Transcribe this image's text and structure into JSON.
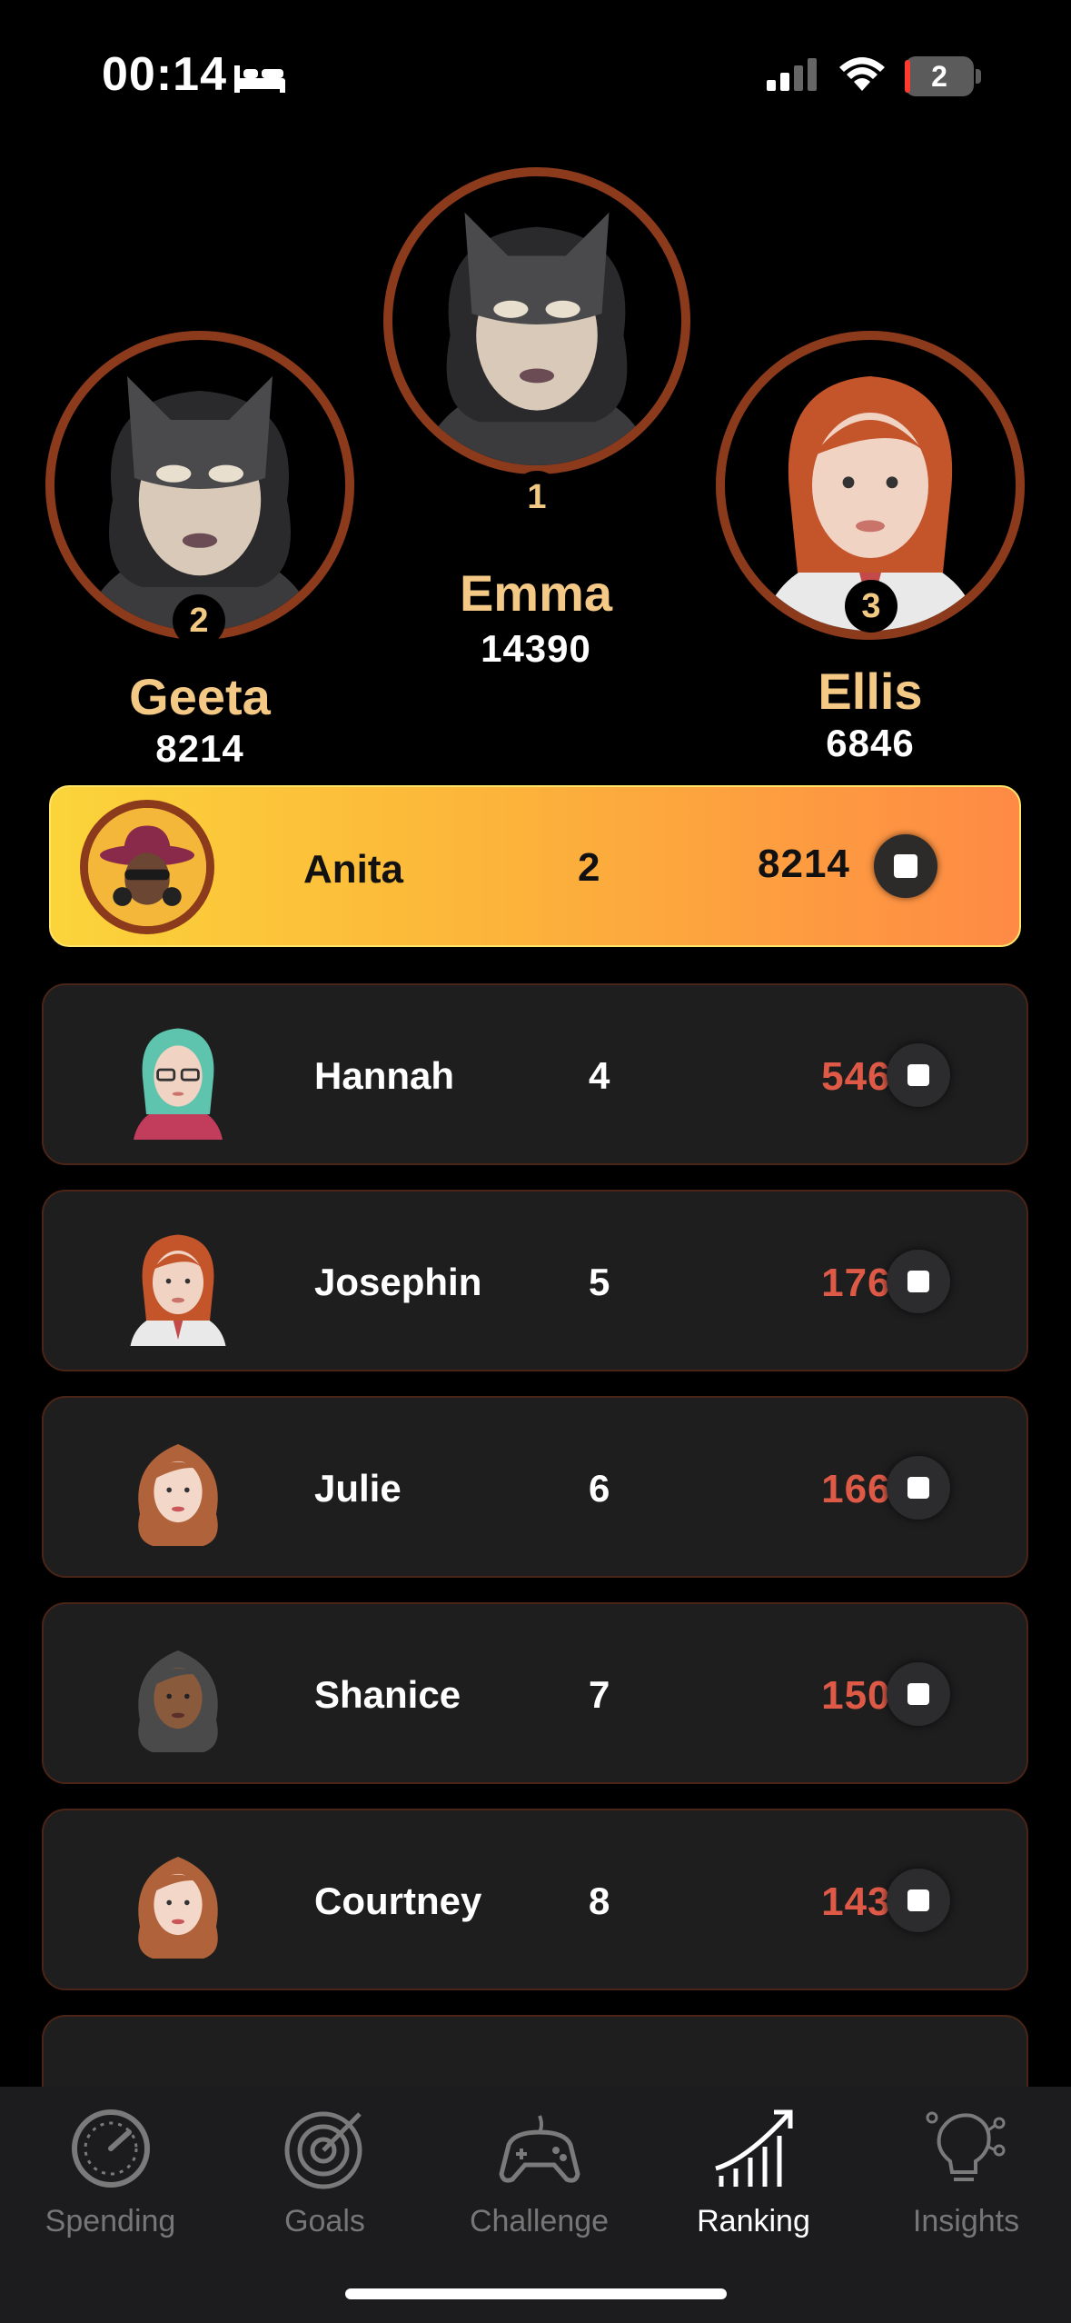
{
  "status": {
    "time": "00:14",
    "battery": "2"
  },
  "podium": [
    {
      "place": "1",
      "name": "Emma",
      "score": "14390"
    },
    {
      "place": "2",
      "name": "Geeta",
      "score": "8214"
    },
    {
      "place": "3",
      "name": "Ellis",
      "score": "6846"
    }
  ],
  "current_user": {
    "name": "Anita",
    "rank": "2",
    "score": "8214"
  },
  "list": [
    {
      "name": "Hannah",
      "rank": "4",
      "score": "5466"
    },
    {
      "name": "Josephin",
      "rank": "5",
      "score": "1765"
    },
    {
      "name": "Julie",
      "rank": "6",
      "score": "1663"
    },
    {
      "name": "Shanice",
      "rank": "7",
      "score": "1505"
    },
    {
      "name": "Courtney",
      "rank": "8",
      "score": "1433"
    }
  ],
  "tabs": [
    {
      "label": "Spending",
      "icon": "gauge-icon"
    },
    {
      "label": "Goals",
      "icon": "target-icon"
    },
    {
      "label": "Challenge",
      "icon": "gamepad-icon"
    },
    {
      "label": "Ranking",
      "icon": "ranking-chart-icon",
      "active": true
    },
    {
      "label": "Insights",
      "icon": "lightbulb-gear-icon"
    }
  ],
  "colors": {
    "ring": "#8c3a1c",
    "gold": "#f4c986",
    "score_red": "#de5a47",
    "row_bg": "#1e1e1f"
  }
}
